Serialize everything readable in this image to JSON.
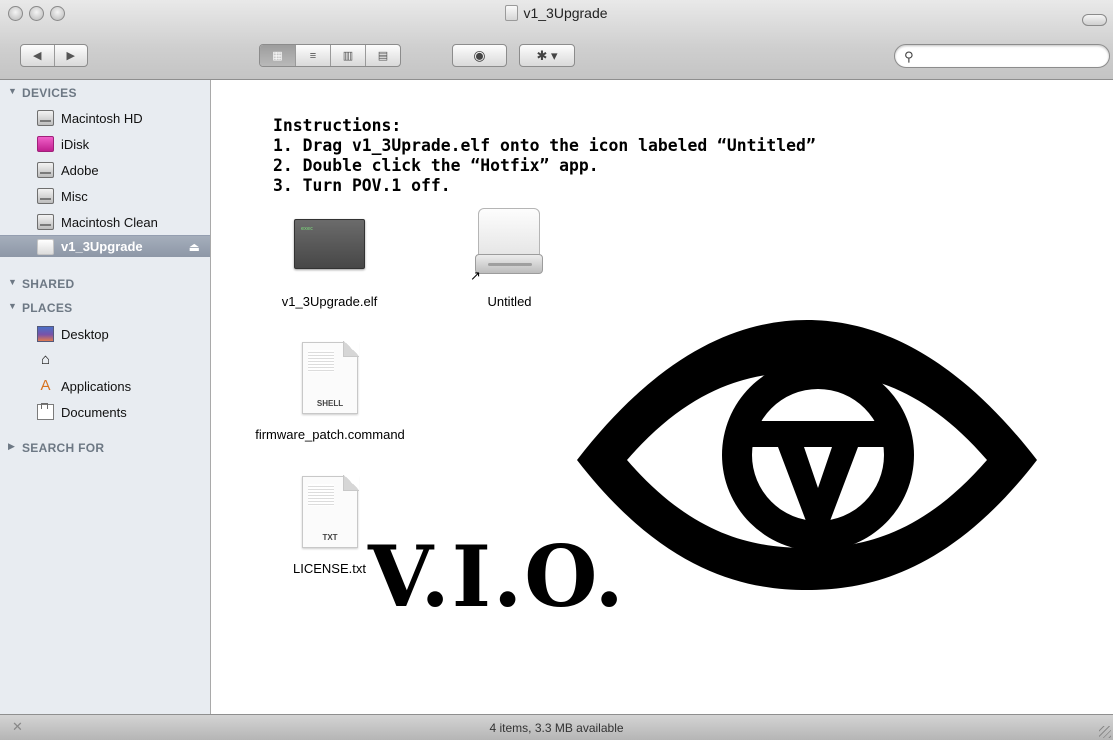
{
  "window": {
    "title": "v1_3Upgrade"
  },
  "toolbar": {
    "back_label": "◀",
    "forward_label": "▶",
    "view_icons_label": "▦",
    "view_list_label": "≡",
    "view_columns_label": "▥",
    "view_coverflow_label": "▤",
    "quicklook_label": "◉",
    "action_label": "✱ ▾",
    "search_placeholder": ""
  },
  "sidebar": {
    "devices_header": "DEVICES",
    "devices": [
      {
        "label": "Macintosh HD",
        "icon": "hard-drive-icon"
      },
      {
        "label": "iDisk",
        "icon": "idisk-icon"
      },
      {
        "label": "Adobe",
        "icon": "hard-drive-icon"
      },
      {
        "label": "Misc",
        "icon": "hard-drive-icon"
      },
      {
        "label": "Macintosh Clean",
        "icon": "hard-drive-icon"
      },
      {
        "label": "v1_3Upgrade",
        "icon": "disk-image-icon",
        "selected": true
      }
    ],
    "eject_label": "⏏",
    "shared_header": "SHARED",
    "places_header": "PLACES",
    "places": [
      {
        "label": "Desktop",
        "icon": "desktop-icon"
      },
      {
        "label": "",
        "icon": "home-icon"
      },
      {
        "label": "Applications",
        "icon": "applications-icon"
      },
      {
        "label": "Documents",
        "icon": "documents-icon"
      }
    ],
    "search_header": "SEARCH FOR"
  },
  "content": {
    "instructions": [
      "Instructions:",
      "1. Drag v1_3Uprade.elf onto the icon labeled “Untitled”",
      "2. Double click the “Hotfix” app.",
      "3. Turn POV.1 off."
    ],
    "files": [
      {
        "name": "v1_3Upgrade.elf",
        "icon": "unix-executable-icon"
      },
      {
        "name": "Untitled",
        "icon": "drive-alias-icon"
      },
      {
        "name": "firmware_patch.command",
        "icon": "shell-document-icon",
        "tag": "SHELL"
      },
      {
        "name": "LICENSE.txt",
        "icon": "text-document-icon",
        "tag": "TXT"
      }
    ],
    "brand_text": "V.I.O."
  },
  "statusbar": {
    "text": "4 items, 3.3 MB available"
  },
  "colors": {
    "sidebar_bg": "#e8ecf1",
    "sidebar_selected": "#8d97a7",
    "header_text": "#6d7884"
  }
}
